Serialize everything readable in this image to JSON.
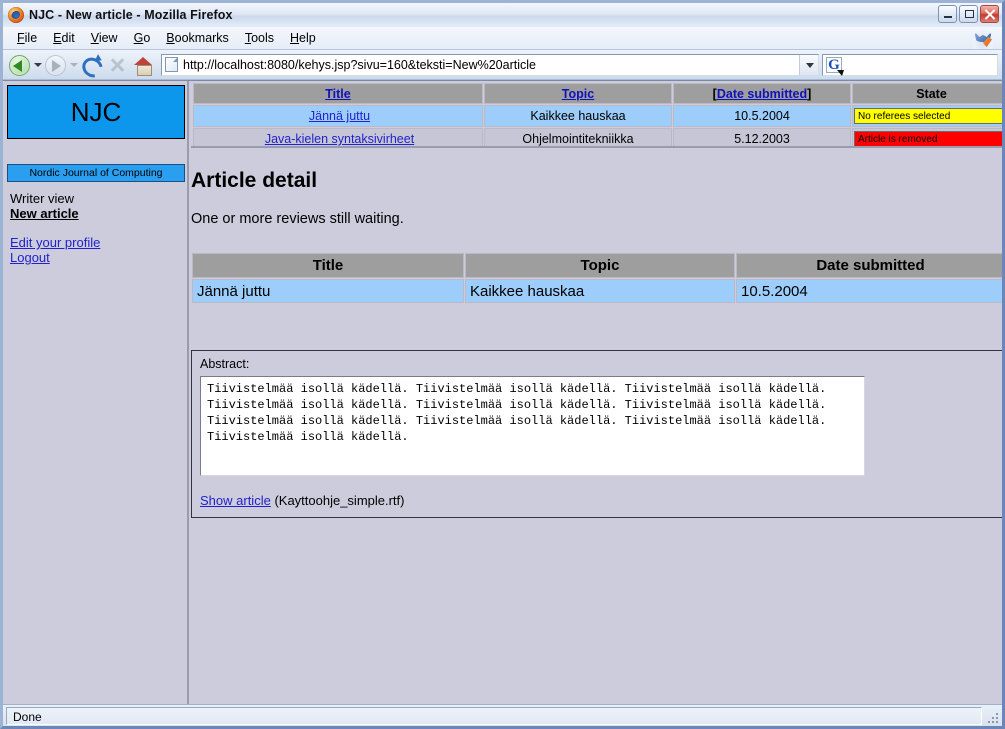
{
  "window": {
    "title": "NJC - New article - Mozilla Firefox",
    "app_icon": "firefox-icon",
    "minimize_label": "Minimize",
    "maximize_label": "Maximize",
    "close_label": "Close"
  },
  "menubar": {
    "items": [
      {
        "label": "File",
        "accesskey": "F"
      },
      {
        "label": "Edit",
        "accesskey": "E"
      },
      {
        "label": "View",
        "accesskey": "V"
      },
      {
        "label": "Go",
        "accesskey": "G"
      },
      {
        "label": "Bookmarks",
        "accesskey": "B"
      },
      {
        "label": "Tools",
        "accesskey": "T"
      },
      {
        "label": "Help",
        "accesskey": "H"
      }
    ]
  },
  "toolbar": {
    "back_icon": "back-arrow-icon",
    "forward_icon": "forward-arrow-icon",
    "reload_icon": "reload-icon",
    "stop_icon": "stop-icon",
    "home_icon": "home-icon",
    "url": "http://localhost:8080/kehys.jsp?sivu=160&teksti=New%20article",
    "url_placeholder": "",
    "url_dropdown_icon": "chevron-down-icon",
    "search_value": "",
    "search_placeholder": "",
    "search_provider_icon": "google-g-icon",
    "search_provider_letter": "G"
  },
  "sidebar": {
    "logo_text": "NJC",
    "banner_text": "Nordic Journal of Computing",
    "view_label": "Writer view",
    "current_page": "New article",
    "links": [
      {
        "label": "Edit your profile"
      },
      {
        "label": "Logout"
      }
    ]
  },
  "article_list": {
    "columns": [
      {
        "label": "Title",
        "link": true,
        "bracketed": false
      },
      {
        "label": "Topic",
        "link": true,
        "bracketed": false
      },
      {
        "label": "Date submitted",
        "link": true,
        "bracketed": true
      },
      {
        "label": "State",
        "link": false,
        "bracketed": false
      }
    ],
    "rows": [
      {
        "title": "Jännä juttu",
        "topic": "Kaikkee hauskaa",
        "date": "10.5.2004",
        "state": "No referees selected",
        "state_color": "#ffff00",
        "selected": true
      },
      {
        "title": "Java-kielen syntaksivirheet",
        "topic": "Ohjelmointitekniikka",
        "date": "5.12.2003",
        "state": "Article is removed",
        "state_color": "#ff0000",
        "selected": false
      }
    ]
  },
  "main": {
    "heading": "Article detail",
    "status_message": "One or more reviews still waiting.",
    "detail_table": {
      "columns": [
        "Title",
        "Topic",
        "Date submitted"
      ],
      "row": [
        "Jännä juttu",
        "Kaikkee hauskaa",
        "10.5.2004"
      ]
    },
    "abstract_label": "Abstract:",
    "abstract_text": "Tiivistelmää isollä kädellä. Tiivistelmää isollä kädellä. Tiivistelmää isollä kädellä. Tiivistelmää isollä kädellä. Tiivistelmää isollä kädellä. Tiivistelmää isollä kädellä. Tiivistelmää isollä kädellä. Tiivistelmää isollä kädellä. Tiivistelmää isollä kädellä. Tiivistelmää isollä kädellä.",
    "show_article_link": "Show article",
    "attachment_name": "(Kayttoohje_simple.rtf)"
  },
  "statusbar": {
    "message": "Done",
    "grip_icon": "resize-grip-icon"
  },
  "colors": {
    "accent_blue": "#0d97ec",
    "selected_row": "#9ccdfb",
    "header_gray": "#9e9e9e",
    "page_bg": "#ccccdd",
    "link": "#2222cc",
    "warn_yellow": "#ffff00",
    "error_red": "#ff0000"
  }
}
